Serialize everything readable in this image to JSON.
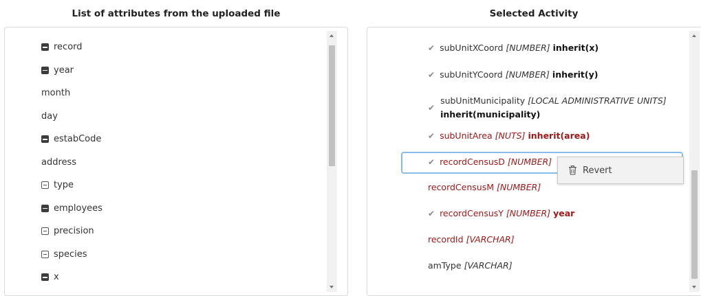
{
  "left_panel": {
    "title": "List of attributes from the uploaded file",
    "items": [
      {
        "label": "record",
        "icon": "filled-square"
      },
      {
        "label": "year",
        "icon": "filled-square"
      },
      {
        "label": "month",
        "icon": "none"
      },
      {
        "label": "day",
        "icon": "none"
      },
      {
        "label": "estabCode",
        "icon": "filled-square"
      },
      {
        "label": "address",
        "icon": "none"
      },
      {
        "label": "type",
        "icon": "outline-square"
      },
      {
        "label": "employees",
        "icon": "filled-square"
      },
      {
        "label": "precision",
        "icon": "outline-square"
      },
      {
        "label": "species",
        "icon": "outline-square"
      },
      {
        "label": "x",
        "icon": "filled-square"
      }
    ]
  },
  "right_panel": {
    "title": "Selected Activity",
    "items": [
      {
        "name": "subUnitXCoord",
        "type": "[NUMBER]",
        "inherit": "inherit(x)",
        "checked": true,
        "color": "#333333"
      },
      {
        "name": "subUnitYCoord",
        "type": "[NUMBER]",
        "inherit": "inherit(y)",
        "checked": true,
        "color": "#333333"
      },
      {
        "name": "subUnitMunicipality",
        "type": "[LOCAL ADMINISTRATIVE UNITS]",
        "inherit": "inherit(municipality)",
        "checked": true,
        "color": "#333333"
      },
      {
        "name": "subUnitArea",
        "type": "[NUTS]",
        "inherit": "inherit(area)",
        "checked": true,
        "color": "#a01818"
      },
      {
        "name": "recordCensusD",
        "type": "[NUMBER]",
        "inherit": "",
        "checked": true,
        "color": "#a01818",
        "selected": true
      },
      {
        "name": "recordCensusM",
        "type": "[NUMBER]",
        "inherit": "",
        "checked": false,
        "color": "#a01818"
      },
      {
        "name": "recordCensusY",
        "type": "[NUMBER]",
        "inherit": "year",
        "checked": true,
        "color": "#a01818"
      },
      {
        "name": "recordId",
        "type": "[VARCHAR]",
        "inherit": "",
        "checked": false,
        "color": "#a01818"
      },
      {
        "name": "amType",
        "type": "[VARCHAR]",
        "inherit": "",
        "checked": false,
        "color": "#333333"
      }
    ]
  },
  "context_menu": {
    "revert_label": "Revert",
    "icon": "trash-icon"
  },
  "colors": {
    "accent_red": "#a01818",
    "selection_border": "#88bce8",
    "check_gray": "#8a8a8a"
  }
}
